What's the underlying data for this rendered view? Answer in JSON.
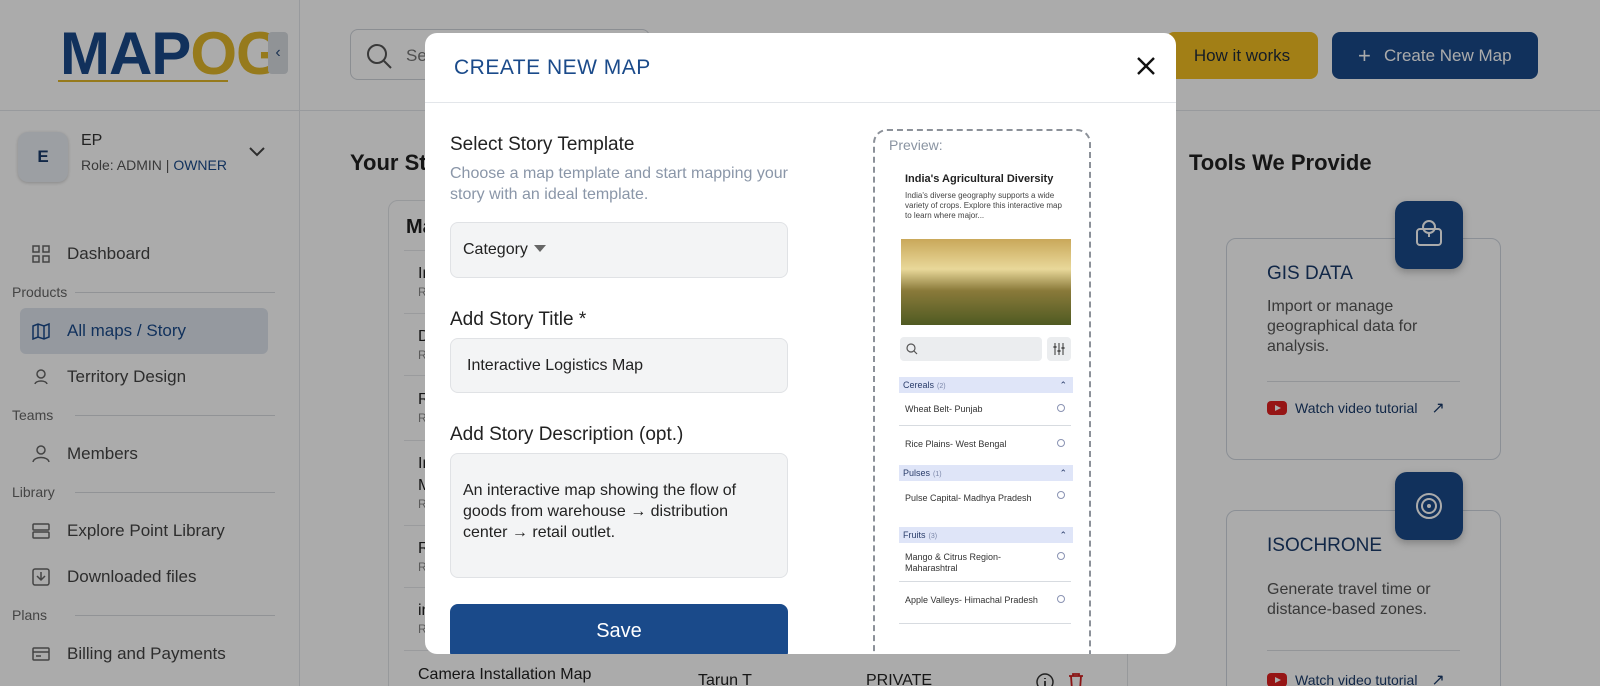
{
  "brand": {
    "logo_part1": "MAP",
    "logo_part2": "OG"
  },
  "user": {
    "initial": "E",
    "name": "EP",
    "role_prefix": "Role: ADMIN | ",
    "role_owner": "OWNER"
  },
  "sidebar": {
    "dashboard": "Dashboard",
    "sections": {
      "products": "Products",
      "teams": "Teams",
      "library": "Library",
      "plans": "Plans"
    },
    "items": {
      "all_maps": "All maps / Story",
      "territory": "Territory Design",
      "members": "Members",
      "explore": "Explore Point Library",
      "downloaded": "Downloaded files",
      "billing": "Billing and Payments"
    }
  },
  "header": {
    "search_placeholder": "Se",
    "how_it_works": "How it works",
    "create_new_map": "Create New Map"
  },
  "main": {
    "your_stories_title": "Your Sto",
    "table_head": "Ma",
    "rows": [
      {
        "title": "In",
        "sub": "R"
      },
      {
        "title": "D",
        "sub": "R"
      },
      {
        "title": "R",
        "sub": "R"
      },
      {
        "title": "In",
        "title2": "M",
        "sub": "R"
      },
      {
        "title": "R",
        "sub": "R"
      },
      {
        "title": "in",
        "sub": "R"
      }
    ],
    "last_row": {
      "name": "Camera Installation Map",
      "owner": "Tarun T",
      "access": "PRIVATE"
    },
    "tools_title": "Tools We Provide",
    "tools": [
      {
        "title": "GIS DATA",
        "desc": "Import or manage geographical data for analysis.",
        "link": "Watch video tutorial"
      },
      {
        "title": "ISOCHRONE",
        "desc": "Generate travel time or distance-based zones.",
        "link": "Watch video tutorial"
      }
    ]
  },
  "modal": {
    "title": "CREATE NEW MAP",
    "template_label": "Select Story Template",
    "template_help": "Choose a map template and start mapping your story with an ideal template.",
    "category_value": "Category",
    "title_label": "Add Story Title *",
    "title_value": "Interactive Logistics Map",
    "desc_label": "Add Story Description (opt.)",
    "desc_value": "An interactive map showing the flow of goods from warehouse → distribution center → retail outlet.",
    "save": "Save",
    "preview": {
      "label": "Preview:",
      "title": "India's Agricultural Diversity",
      "text": "India's diverse geography supports a wide variety of crops. Explore this interactive map to learn where major...",
      "categories": [
        {
          "name": "Cereals",
          "count": "(2)"
        },
        {
          "name": "Pulses",
          "count": "(1)"
        },
        {
          "name": "Fruits",
          "count": "(3)"
        }
      ],
      "items": [
        "Wheat Belt- Punjab",
        "Rice Plains- West Bengal",
        "Pulse Capital- Madhya Pradesh",
        "Mango & Citrus Region- Maharashtral",
        "Apple Valleys- Himachal Pradesh"
      ]
    }
  },
  "colors": {
    "primary": "#1a4a8a",
    "accent": "#f2be22"
  }
}
